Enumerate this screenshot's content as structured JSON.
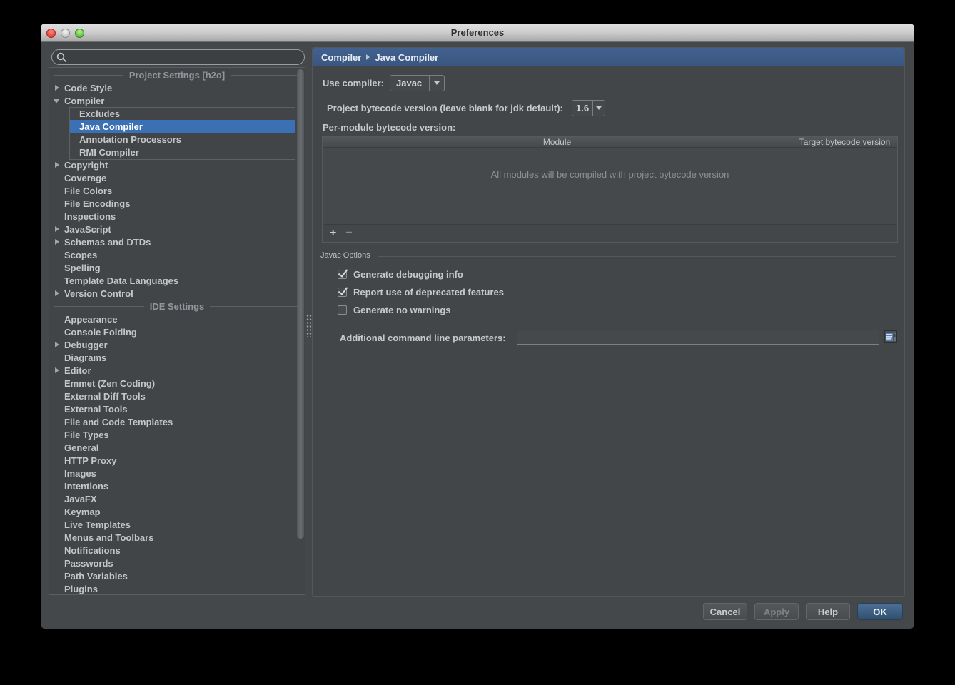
{
  "window": {
    "title": "Preferences"
  },
  "traffic_lights": {
    "close": "close-red",
    "minimize": "minimize-gray",
    "zoom": "zoom-green"
  },
  "sidebar": {
    "search_value": "",
    "tree_rows": [
      {
        "type": "header",
        "label": "Project Settings [h2o]"
      },
      {
        "type": "item",
        "arrow": "right",
        "label": "Code Style"
      },
      {
        "type": "item",
        "arrow": "down",
        "label": "Compiler"
      },
      {
        "type": "child",
        "label": "Excludes"
      },
      {
        "type": "child",
        "label": "Java Compiler",
        "selected": true
      },
      {
        "type": "child",
        "label": "Annotation Processors"
      },
      {
        "type": "child",
        "label": "RMI Compiler"
      },
      {
        "type": "item",
        "arrow": "right",
        "label": "Copyright"
      },
      {
        "type": "item",
        "label": "Coverage"
      },
      {
        "type": "item",
        "label": "File Colors"
      },
      {
        "type": "item",
        "label": "File Encodings"
      },
      {
        "type": "item",
        "label": "Inspections"
      },
      {
        "type": "item",
        "arrow": "right",
        "label": "JavaScript"
      },
      {
        "type": "item",
        "arrow": "right",
        "label": "Schemas and DTDs"
      },
      {
        "type": "item",
        "label": "Scopes"
      },
      {
        "type": "item",
        "label": "Spelling"
      },
      {
        "type": "item",
        "label": "Template Data Languages"
      },
      {
        "type": "item",
        "arrow": "right",
        "label": "Version Control"
      },
      {
        "type": "header",
        "label": "IDE Settings"
      },
      {
        "type": "item",
        "label": "Appearance"
      },
      {
        "type": "item",
        "label": "Console Folding"
      },
      {
        "type": "item",
        "arrow": "right",
        "label": "Debugger"
      },
      {
        "type": "item",
        "label": "Diagrams"
      },
      {
        "type": "item",
        "arrow": "right",
        "label": "Editor"
      },
      {
        "type": "item",
        "label": "Emmet (Zen Coding)"
      },
      {
        "type": "item",
        "label": "External Diff Tools"
      },
      {
        "type": "item",
        "label": "External Tools"
      },
      {
        "type": "item",
        "label": "File and Code Templates"
      },
      {
        "type": "item",
        "label": "File Types"
      },
      {
        "type": "item",
        "label": "General"
      },
      {
        "type": "item",
        "label": "HTTP Proxy"
      },
      {
        "type": "item",
        "label": "Images"
      },
      {
        "type": "item",
        "label": "Intentions"
      },
      {
        "type": "item",
        "label": "JavaFX"
      },
      {
        "type": "item",
        "label": "Keymap"
      },
      {
        "type": "item",
        "label": "Live Templates"
      },
      {
        "type": "item",
        "label": "Menus and Toolbars"
      },
      {
        "type": "item",
        "label": "Notifications"
      },
      {
        "type": "item",
        "label": "Passwords"
      },
      {
        "type": "item",
        "label": "Path Variables"
      },
      {
        "type": "item",
        "label": "Plugins"
      }
    ]
  },
  "main": {
    "breadcrumb": {
      "0": "Compiler",
      "1": "Java Compiler"
    },
    "use_compiler_label": "Use compiler:",
    "use_compiler_value": "Javac",
    "bytecode_label": "Project bytecode version (leave blank for jdk default):",
    "bytecode_value": "1.6",
    "per_module_label": "Per-module bytecode version:",
    "table": {
      "columns": {
        "0": "Module",
        "1": "Target bytecode version"
      },
      "empty_text": "All modules will be compiled with project bytecode version"
    },
    "toolbar": {
      "add_label": "+",
      "remove_label": "−"
    },
    "javac_options": {
      "title": "Javac Options",
      "checkboxes": [
        {
          "label": "Generate debugging info",
          "checked": true
        },
        {
          "label": "Report use of deprecated features",
          "checked": true
        },
        {
          "label": "Generate no warnings",
          "checked": false
        }
      ]
    },
    "additional_params_label": "Additional command line parameters:",
    "additional_params_value": ""
  },
  "footer": {
    "cancel_label": "Cancel",
    "apply_label": "Apply",
    "help_label": "Help",
    "ok_label": "OK"
  },
  "colors": {
    "selection_blue": "#3b70b5",
    "header_bar_blue": "#3d5c88",
    "ok_button_blue": "#3c5d82",
    "panel_background": "#434649",
    "window_background": "#45484b"
  }
}
